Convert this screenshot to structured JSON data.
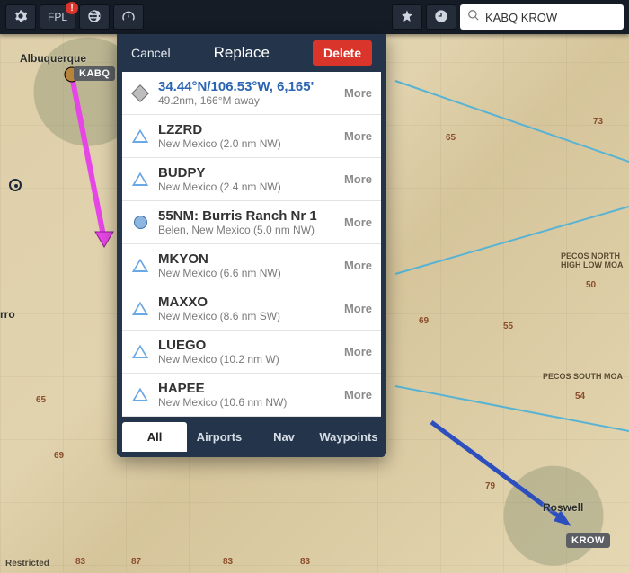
{
  "toolbar": {
    "fpl_label": "FPL",
    "fpl_badge": "!",
    "search_value": "KABQ KROW"
  },
  "map": {
    "city_albuquerque": "Albuquerque",
    "city_roswell": "Roswell",
    "airport_kabq": "KABQ",
    "airport_krow": "KROW",
    "label_rro": "rro",
    "nums": [
      "65",
      "69",
      "65",
      "73",
      "69",
      "83",
      "87",
      "83",
      "83",
      "50",
      "55",
      "54",
      "79"
    ],
    "moa1": "PECOS NORTH\nHIGH LOW MOA",
    "moa2": "PECOS SOUTH MOA",
    "restricted": "Restricted"
  },
  "popup": {
    "cancel": "Cancel",
    "title": "Replace",
    "delete": "Delete",
    "more": "More",
    "rows": [
      {
        "kind": "diamond",
        "name": "34.44°N/106.53°W, 6,165'",
        "sub": "49.2nm, 166°M away",
        "selected": true
      },
      {
        "kind": "tri",
        "name": "LZZRD",
        "sub": "New Mexico  (2.0 nm NW)"
      },
      {
        "kind": "tri",
        "name": "BUDPY",
        "sub": "New Mexico  (2.4 nm NW)"
      },
      {
        "kind": "circle",
        "name": "55NM: Burris Ranch Nr 1",
        "sub": "Belen, New Mexico  (5.0 nm NW)"
      },
      {
        "kind": "tri",
        "name": "MKYON",
        "sub": "New Mexico  (6.6 nm NW)"
      },
      {
        "kind": "tri",
        "name": "MAXXO",
        "sub": "New Mexico  (8.6 nm SW)"
      },
      {
        "kind": "tri",
        "name": "LUEGO",
        "sub": "New Mexico  (10.2 nm W)"
      },
      {
        "kind": "tri",
        "name": "HAPEE",
        "sub": "New Mexico  (10.6 nm NW)"
      }
    ],
    "tabs": {
      "all": "All",
      "airports": "Airports",
      "nav": "Nav",
      "waypoints": "Waypoints",
      "active": "all"
    }
  }
}
